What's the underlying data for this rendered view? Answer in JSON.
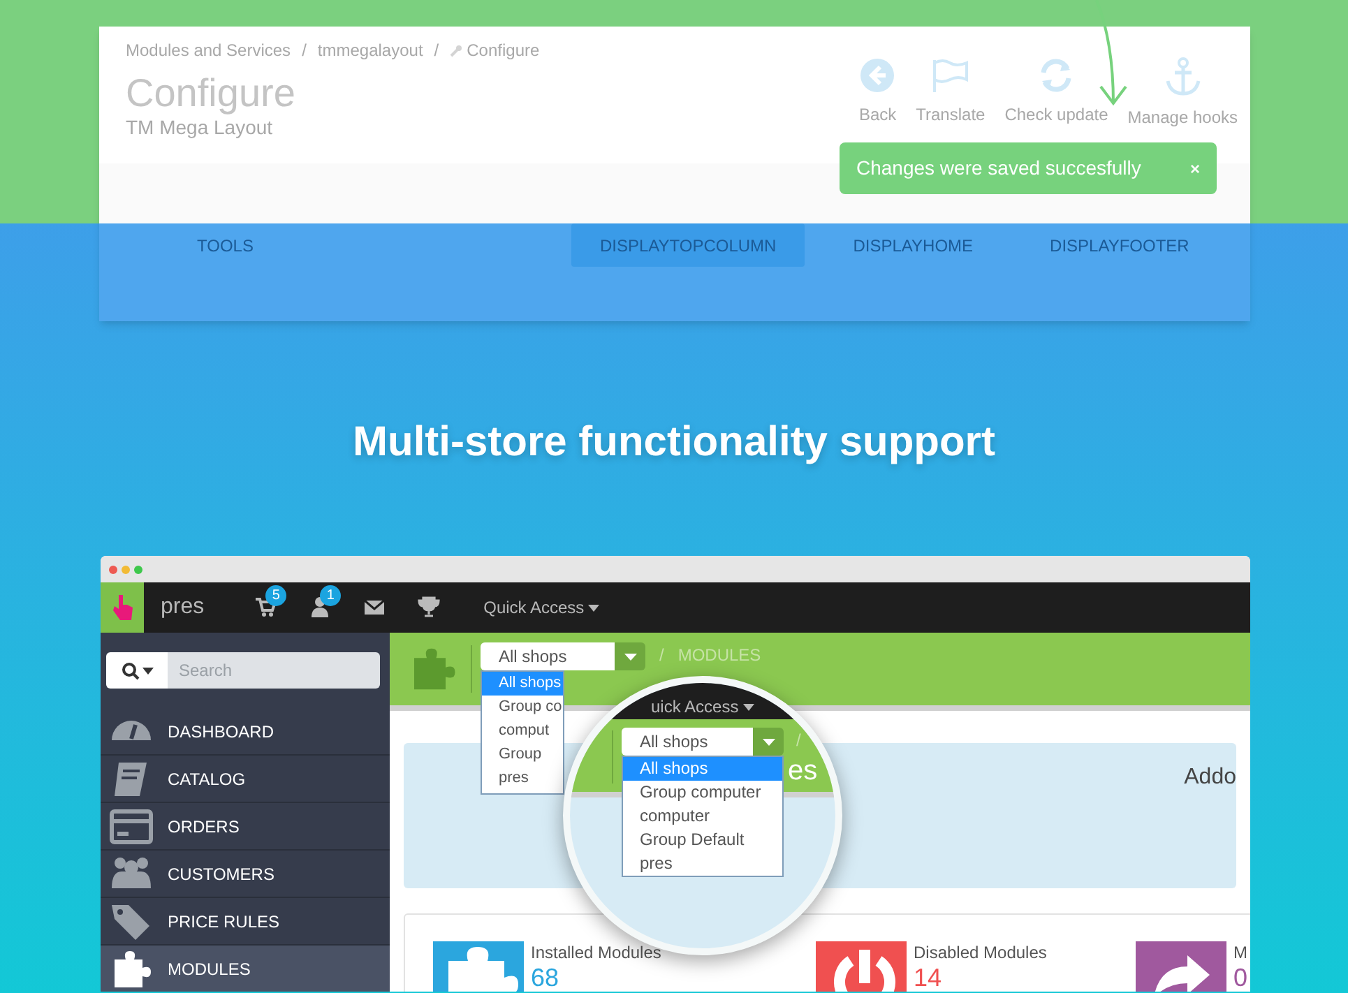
{
  "config_panel": {
    "breadcrumb": [
      {
        "text": "Modules and Services"
      },
      {
        "text": "/"
      },
      {
        "text": "tmmegalayout"
      },
      {
        "text": "/"
      },
      {
        "text": "Configure",
        "kind": "wrench"
      }
    ],
    "title": "Configure",
    "subtitle": "TM Mega Layout",
    "toolbar": [
      {
        "label": "Back",
        "kind": "back"
      },
      {
        "label": "Translate",
        "kind": "flag"
      },
      {
        "label": "Check update",
        "kind": "refresh"
      },
      {
        "label": "Manage hooks",
        "kind": "anchor"
      }
    ],
    "toast": {
      "message": "Changes were saved succesfully",
      "close": "×"
    },
    "tabs": [
      {
        "label": "TOOLS",
        "selected": false
      },
      {
        "label": "DISPLAYTOPCOLUMN",
        "selected": true
      },
      {
        "label": "DISPLAYHOME",
        "selected": false
      },
      {
        "label": "DISPLAYFOOTER",
        "selected": false
      }
    ]
  },
  "heading": "Multi-store functionality support",
  "browser": {
    "nav": {
      "shop_name": "pres",
      "icons": [
        {
          "kind": "cart",
          "badge": "5"
        },
        {
          "kind": "user",
          "badge": "1"
        },
        {
          "kind": "mail"
        },
        {
          "kind": "trophy"
        }
      ],
      "quick_access": "Quick Access"
    },
    "search": {
      "placeholder": "Search"
    },
    "sidebar": {
      "items": [
        {
          "label": "DASHBOARD",
          "kind": "dashboard",
          "selected": false
        },
        {
          "label": "CATALOG",
          "kind": "catalog",
          "selected": false
        },
        {
          "label": "ORDERS",
          "kind": "orders",
          "selected": false
        },
        {
          "label": "CUSTOMERS",
          "kind": "customers",
          "selected": false
        },
        {
          "label": "PRICE RULES",
          "kind": "tag",
          "selected": false
        },
        {
          "label": "MODULES",
          "kind": "puzzle",
          "selected": true
        }
      ]
    },
    "shop_select": {
      "value": "All shops",
      "options": [
        {
          "label": "All shops",
          "selected": true
        },
        {
          "label": "Group co",
          "selected": false
        },
        {
          "label": "comput",
          "selected": false
        },
        {
          "label": "Group",
          "selected": false
        },
        {
          "label": "pres",
          "selected": false
        }
      ]
    },
    "breadcrumb": [
      {
        "text": "/"
      },
      {
        "text": "MODULES"
      }
    ],
    "addons_label": "Addo",
    "stats": [
      {
        "label": "Installed Modules",
        "value": "68",
        "kind": "puzzle",
        "color": "#2ba6de"
      },
      {
        "label": "Disabled Modules",
        "value": "14",
        "kind": "power",
        "color": "#f05050"
      },
      {
        "label": "M",
        "value": "0",
        "kind": "refresh",
        "color": "#a0599e"
      }
    ],
    "magnifier": {
      "quick_access": "uick Access",
      "title_fragment": "es",
      "separator": "/",
      "shop_select": {
        "value": "All shops",
        "options": [
          {
            "label": "All shops",
            "selected": true
          },
          {
            "label": "Group computer",
            "selected": false
          },
          {
            "label": "computer",
            "selected": false
          },
          {
            "label": "Group Default",
            "selected": false
          },
          {
            "label": "pres",
            "selected": false
          }
        ]
      }
    }
  }
}
